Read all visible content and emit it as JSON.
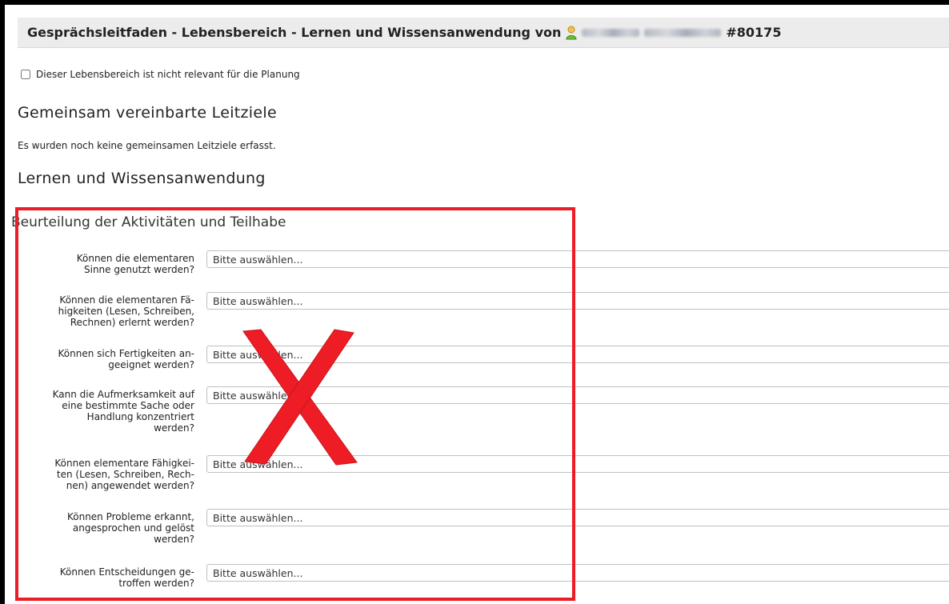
{
  "header": {
    "title_prefix": "Gesprächsleitfaden - Lebensbereich - Lernen und Wissensanwendung von",
    "person_icon": "person-icon",
    "client_id": "#80175"
  },
  "not_relevant": {
    "checked": false,
    "label": "Dieser Lebensbereich ist nicht relevant für die Planung"
  },
  "shared_goals": {
    "heading": "Gemeinsam vereinbarte Leitziele",
    "empty_text": "Es wurden noch keine gemeinsamen Leitziele erfasst."
  },
  "area": {
    "heading": "Lernen und Wissensanwendung"
  },
  "assessment": {
    "heading": "Beurteilung der Aktivitäten und Teilhabe",
    "placeholder": "Bitte auswählen...",
    "questions": [
      {
        "lines": [
          "Können die elementaren",
          "Sinne genutzt werden?"
        ],
        "value": "Bitte auswählen..."
      },
      {
        "lines": [
          "Können die elementaren Fä-",
          "higkeiten (Lesen, Schreiben,",
          "Rechnen) erlernt werden?"
        ],
        "value": "Bitte auswählen..."
      },
      {
        "lines": [
          "Können sich Fertigkeiten an-",
          "geeignet werden?"
        ],
        "value": "Bitte auswählen..."
      },
      {
        "lines": [
          "Kann die Aufmerksamkeit auf",
          "eine bestimmte Sache oder",
          "Handlung konzentriert",
          "werden?"
        ],
        "value": "Bitte auswählen..."
      },
      {
        "lines": [
          "Können elementare Fähigkei-",
          "ten (Lesen, Schreiben, Rech-",
          "nen) angewendet werden?"
        ],
        "value": "Bitte auswählen..."
      },
      {
        "lines": [
          "Können Probleme erkannt,",
          "angesprochen und gelöst",
          "werden?"
        ],
        "value": "Bitte auswählen..."
      },
      {
        "lines": [
          "Können Entscheidungen ge-",
          "troffen werden?"
        ],
        "value": "Bitte auswählen..."
      }
    ]
  },
  "annotation": {
    "highlight_color": "#ee1c25",
    "mark": "X"
  }
}
